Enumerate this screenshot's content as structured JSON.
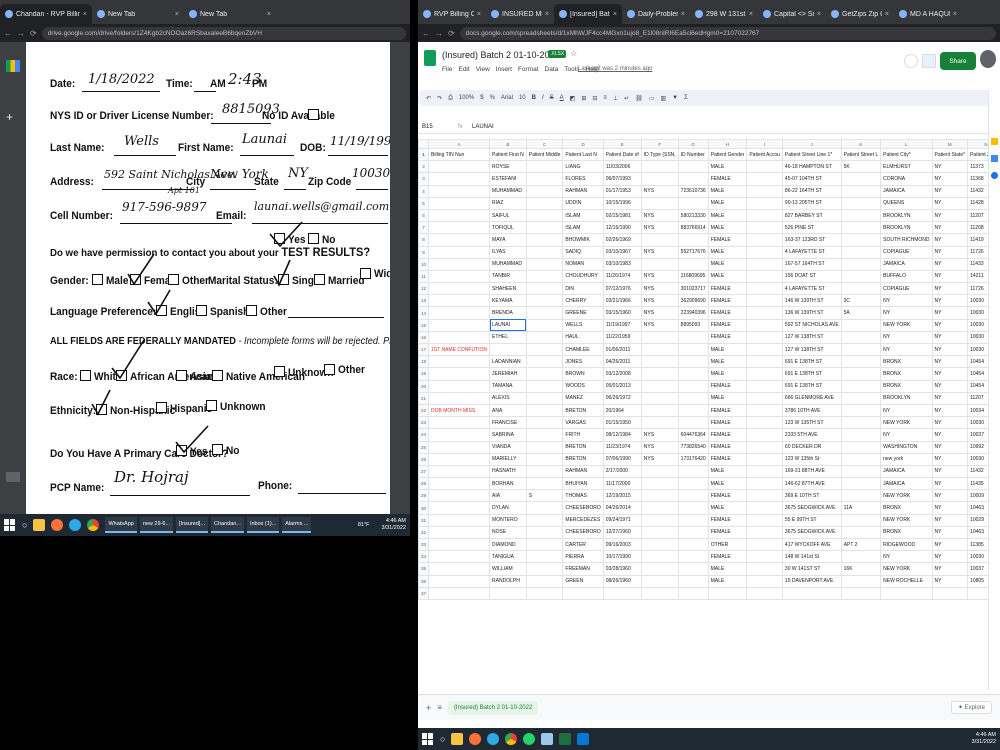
{
  "left_window": {
    "tabs": [
      {
        "label": "Chandan - RVP Billing Company"
      },
      {
        "label": "New Tab"
      },
      {
        "label": "New Tab"
      }
    ],
    "url": "drive.google.com/drive/folders/1Z4Kgb2cNOOaz6RSbaxaleeB6bqenZbVH",
    "form": {
      "date_label": "Date:",
      "date_val": "1/18/2022",
      "time_label": "Time:",
      "time_am": "AM",
      "time_val": "2:43",
      "time_pm": "PM",
      "id_label": "NYS ID or Driver License Number:",
      "id_val": "8815093",
      "noid_label": "No ID Available",
      "last_label": "Last Name:",
      "last_val": "Wells",
      "first_label": "First Name:",
      "first_val": "Launai",
      "dob_label": "DOB:",
      "dob_val": "11/19/1997",
      "addr_label": "Address:",
      "addr_val": "592 Saint Nicholas Ave.",
      "city_label": "City",
      "city_val": "New York",
      "state_label": "State",
      "state_val": "NY",
      "zip_label": "Zip Code",
      "zip_val": "10030",
      "cell_label": "Cell Number:",
      "cell_val": "917-596-9897",
      "apt_note": "Apt 101",
      "email_label": "Email:",
      "email_val": "launai.wells@gmail.com",
      "perm_label": "Do we have permission to contact you about your",
      "perm_bold": "TEST RESULTS?",
      "yes": "Yes",
      "no": "No",
      "gender_label": "Gender:",
      "male": "Male",
      "female": "Female",
      "other": "Other",
      "marital_label": "Marital Status:",
      "single": "Single",
      "married": "Married",
      "widowed": "Widowed",
      "partnered": "Partnered",
      "lang_label": "Language Preference:",
      "english": "English",
      "spanish": "Spanish",
      "lang_other": "Other",
      "mandate_bold": "ALL FIELDS ARE FEDERALLY MANDATED",
      "mandate_rest": "- Incomplete forms will be rejected. Please print legibly.",
      "race_label": "Race:",
      "white": "White",
      "african": "African American",
      "asian": "Asian",
      "native": "Native American",
      "unknown": "Unknown",
      "race_other": "Other",
      "eth_label": "Ethnicity:",
      "nonhisp": "Non-Hispanic",
      "hisp": "Hispanic",
      "eth_unknown": "Unknown",
      "pcd_label": "Do You Have A Primary Care Doctor?",
      "pcd_yes": "Yes",
      "pcd_no": "No",
      "pcp_label": "PCP Name:",
      "pcp_val": "Dr. Hojraj",
      "phone_label": "Phone:"
    },
    "taskbar": {
      "items": [
        "WhatsApp",
        "new 29-6...",
        "[Insured]...",
        "Chandan...",
        "Inbox (1)...",
        "Alarms ..."
      ],
      "temp": "81°F",
      "time": "4:46 AM",
      "date": "3/31/2022"
    }
  },
  "right_window": {
    "tabs": [
      {
        "label": "RVP Billing Company - G"
      },
      {
        "label": "INSURED MEDICAID_MEI"
      },
      {
        "label": "[Insured] Batch 2 01-10-2"
      },
      {
        "label": "Daily-Problem Data_Insu"
      },
      {
        "label": "298 W 131st St - Google I"
      },
      {
        "label": "Capital <> Small Letters C"
      },
      {
        "label": "GetZips Zip Code Lookup"
      },
      {
        "label": "MD A HAQUE - Google S"
      }
    ],
    "url": "docs.google.com/spreadsheets/d/1xMhWJF4cc4MGxn1ujo8_E1l08nIRI6Ea5ci6edHgm0=2107022767",
    "title": "(Insured) Batch 2 01-10-2022",
    "badge": ".XLSX",
    "menu": [
      "File",
      "Edit",
      "View",
      "Insert",
      "Format",
      "Data",
      "Tools",
      "Help"
    ],
    "last_edit": "Last edit was 2 minutes ago",
    "share": "Share",
    "toolbar": {
      "zoom": "100%",
      "font": "Arial",
      "size": "10"
    },
    "cell_ref": "B15",
    "formula": "LAUNAI",
    "col_letters": [
      "A",
      "B",
      "C",
      "D",
      "E",
      "F",
      "G",
      "H",
      "I",
      "J",
      "K",
      "L",
      "M",
      "N",
      "O",
      "P",
      "Q",
      "R"
    ],
    "headers": [
      "Billing TIN Nun",
      "Patient First N",
      "Patient Middle",
      "Patient Last N",
      "Patient Date of",
      "ID Type (SSN,",
      "ID Number",
      "Patient Gender",
      "Patient Accou",
      "Patient Street Line 1*",
      "Patient Street L",
      "Patient City*",
      "Patient State*",
      "Patient Zip Co",
      "Service Type (I",
      "Date of Service",
      "Date of Admis",
      "Date of Discha"
    ],
    "rows": [
      {
        "n": "2",
        "c": [
          "",
          "ROYSE",
          "",
          "LIANG",
          "11/03/2006",
          "",
          "",
          "MALE",
          "",
          "46-18 HAMPTON ST",
          "5K",
          "ELMHURST",
          "NY",
          "11373",
          "",
          "01/08/2022",
          "",
          ""
        ]
      },
      {
        "n": "3",
        "c": [
          "",
          "ESTEFANI",
          "",
          "FLORES",
          "06/07/1993",
          "",
          "",
          "FEMALE",
          "",
          "45-07 104TH ST",
          "",
          "CORONA",
          "NY",
          "11368",
          "",
          "01/05/2021",
          "",
          ""
        ]
      },
      {
        "n": "4",
        "c": [
          "",
          "MUHAMMAD",
          "",
          "RAHMAN",
          "01/17/1953",
          "NYS",
          "723610736",
          "MALE",
          "",
          "86-22 164TH ST",
          "",
          "JAMAICA",
          "NY",
          "11432",
          "",
          "01/08/2022",
          "",
          ""
        ]
      },
      {
        "n": "5",
        "c": [
          "",
          "RIAZ",
          "",
          "UDDIN",
          "10/15/1996",
          "",
          "",
          "MALE",
          "",
          "90-13 205TH ST",
          "",
          "QUEENS",
          "NY",
          "11428",
          "",
          "01/08/2022",
          "",
          ""
        ]
      },
      {
        "n": "6",
        "c": [
          "",
          "SAIFUL",
          "",
          "ISLAM",
          "02/15/1981",
          "NYS",
          "580213330",
          "MALE",
          "",
          "827 BARBEY ST",
          "",
          "BROOKLYN",
          "NY",
          "11207",
          "",
          "01/08/2022",
          "",
          ""
        ]
      },
      {
        "n": "7",
        "c": [
          "",
          "TOFIQUL",
          "",
          "ISLAM",
          "12/16/1990",
          "NYS",
          "883766914",
          "MALE",
          "",
          "526 PINE ST",
          "",
          "BROOKLYN",
          "NY",
          "11208",
          "",
          "01/08/2022",
          "",
          ""
        ]
      },
      {
        "n": "8",
        "c": [
          "",
          "MAYA",
          "",
          "BHOWMIK",
          "02/26/1969",
          "",
          "",
          "FEMALE",
          "",
          "163-37 123RD ST",
          "",
          "SOUTH RICHMOND",
          "NY",
          "11419",
          "",
          "01/08/2022",
          "",
          ""
        ]
      },
      {
        "n": "9",
        "c": [
          "",
          "ILYAS",
          "",
          "SADIQ",
          "03/10/1967",
          "NYS",
          "552717676",
          "MALE",
          "",
          "4 LAFAYETTE ST",
          "",
          "COPIAGUE",
          "NY",
          "11726",
          "",
          "01/08/2022",
          "",
          ""
        ]
      },
      {
        "n": "10",
        "c": [
          "",
          "MUHAMMAD",
          "",
          "NOMAN",
          "03/10/1983",
          "",
          "",
          "MALE",
          "",
          "167-57 164TH ST",
          "",
          "JAMAICA",
          "NY",
          "11433",
          "",
          "01/08/2022",
          "",
          ""
        ]
      },
      {
        "n": "11",
        "c": [
          "",
          "TANBIR",
          "",
          "CHOUDHURY",
          "11/26/1974",
          "NYS",
          "116809695",
          "MALE",
          "",
          "156 DOAT ST",
          "",
          "BUFFALO",
          "NY",
          "14211",
          "",
          "01/08/2022",
          "",
          ""
        ]
      },
      {
        "n": "12",
        "c": [
          "",
          "SHAHEEN",
          "",
          "DIN",
          "07/12/1976",
          "NYS",
          "301023717",
          "FEMALE",
          "",
          "4 LAFAYETTE ST",
          "",
          "COPIAGUE",
          "NY",
          "11726",
          "",
          "01/08/2022",
          "",
          ""
        ]
      },
      {
        "n": "13",
        "c": [
          "",
          "KEYAMA",
          "",
          "CHERRY",
          "03/21/1966",
          "NYS",
          "362909690",
          "FEMALE",
          "",
          "146 W 139TH ST",
          "3C",
          "NY",
          "NY",
          "10030",
          "",
          "01/08/2022",
          "",
          ""
        ]
      },
      {
        "n": "14",
        "c": [
          "",
          "BRENDA",
          "",
          "GREENE",
          "03/15/1960",
          "NYS",
          "223940396",
          "FEMALE",
          "",
          "136 W 139TH ST",
          "5A",
          "NY",
          "NY",
          "10030",
          "",
          "01/08/2022",
          "",
          ""
        ]
      },
      {
        "n": "15",
        "c": [
          "",
          "LAUNAI",
          "",
          "WELLS",
          "11/19/1997",
          "NYS",
          "8895093",
          "FEMALE",
          "",
          "592 ST NICHOLAS AVE",
          "",
          "NEW YORK",
          "NY",
          "10030",
          "",
          "01/08/2022",
          "",
          ""
        ]
      },
      {
        "n": "16",
        "c": [
          "",
          "ETHEL",
          "",
          "HAUL",
          "11/22/1959",
          "",
          "",
          "FEMALE",
          "",
          "127 W 138TH ST",
          "",
          "NY",
          "NY",
          "10030",
          "",
          "01/08/2022",
          "",
          ""
        ]
      },
      {
        "n": "17",
        "c": [
          "1ST NAME CONFUTION",
          "",
          "",
          "CHAMLEE",
          "01/06/2011",
          "",
          "",
          "MALE",
          "",
          "127 W 138TH ST",
          "",
          "NY",
          "NY",
          "10030",
          "",
          "01/08/2022",
          "",
          ""
        ]
      },
      {
        "n": "18",
        "c": [
          "",
          "LADANNIAN",
          "",
          "JONES",
          "04/26/2011",
          "",
          "",
          "MALE",
          "",
          "691 E 138TH ST",
          "",
          "BRONX",
          "NY",
          "10454",
          "",
          "01/08/2022",
          "",
          ""
        ]
      },
      {
        "n": "19",
        "c": [
          "",
          "JEREMIAH",
          "",
          "BROWN",
          "03/12/2008",
          "",
          "",
          "MALE",
          "",
          "691 E 138TH ST",
          "",
          "BRONX",
          "NY",
          "10454",
          "",
          "01/08/2022",
          "",
          ""
        ]
      },
      {
        "n": "20",
        "c": [
          "",
          "TAMANA",
          "",
          "WOODS",
          "05/01/2013",
          "",
          "",
          "FEMALE",
          "",
          "691 E 138TH ST",
          "",
          "BRONX",
          "NY",
          "10454",
          "",
          "01/08/2022",
          "",
          ""
        ]
      },
      {
        "n": "21",
        "c": [
          "",
          "ALEXIS",
          "",
          "MANEZ",
          "06/26/1972",
          "",
          "",
          "MALE",
          "",
          "666 GLENMORE AVE",
          "",
          "BROOKLYN",
          "NY",
          "11207",
          "",
          "01/08/2022",
          "",
          ""
        ]
      },
      {
        "n": "22",
        "c": [
          "DOB MONTH MISS",
          "ANA",
          "",
          "BRETON",
          "20/1964",
          "",
          "",
          "FEMALE",
          "",
          "3786 10TH AVE",
          "",
          "NY",
          "NY",
          "10034",
          "",
          "01/08/2022",
          "",
          ""
        ]
      },
      {
        "n": "23",
        "c": [
          "",
          "FRANCISE",
          "",
          "VARGAS",
          "01/15/1950",
          "",
          "",
          "FEMALE",
          "",
          "123 W 135TH ST",
          "",
          "NEW YORK",
          "NY",
          "10030",
          "",
          "01/08/2022",
          "",
          ""
        ]
      },
      {
        "n": "24",
        "c": [
          "",
          "SABRINA",
          "",
          "FRITH",
          "08/12/1984",
          "NYS",
          "604476364",
          "FEMALE",
          "",
          "2333 5TH AVE",
          "",
          "NY",
          "NY",
          "10037",
          "",
          "01/08/2022",
          "",
          ""
        ]
      },
      {
        "n": "25",
        "c": [
          "",
          "VIANDA",
          "",
          "BRETON",
          "11/23/1974",
          "NYS",
          "773826540",
          "FEMALE",
          "",
          "60 DECKER DR",
          "",
          "WASHINGTON",
          "NY",
          "10992",
          "",
          "01/08/2022",
          "",
          ""
        ]
      },
      {
        "n": "26",
        "c": [
          "",
          "MARIELLY",
          "",
          "BRETON",
          "07/06/1990",
          "NYS",
          "173176420",
          "FEMALE",
          "",
          "123 W 135th St",
          "",
          "new york",
          "NY",
          "10030",
          "",
          "01/08/2022",
          "",
          ""
        ]
      },
      {
        "n": "27",
        "c": [
          "",
          "HASNATH",
          "",
          "RAHMAN",
          "2/17/2000",
          "",
          "",
          "MALE",
          "",
          "169-31 88TH AVE",
          "",
          "JAMAICA",
          "NY",
          "11432",
          "",
          "01/08/2022",
          "",
          ""
        ]
      },
      {
        "n": "28",
        "c": [
          "",
          "BORHAN",
          "",
          "BHUIYAN",
          "11/17/2000",
          "",
          "",
          "MALE",
          "",
          "146-62 87TH AVE",
          "",
          "JAMAICA",
          "NY",
          "11435",
          "",
          "01/08/2022",
          "",
          ""
        ]
      },
      {
        "n": "29",
        "c": [
          "",
          "AIA",
          "S",
          "THOMAS",
          "12/19/2015",
          "",
          "",
          "FEMALE",
          "",
          "369 E 10TH ST",
          "",
          "NEW YORK",
          "NY",
          "10009",
          "",
          "01/08/2022",
          "",
          ""
        ]
      },
      {
        "n": "30",
        "c": [
          "",
          "DYLAN",
          "",
          "CHEESEBORO",
          "04/26/2014",
          "",
          "",
          "MALE",
          "",
          "3675 SEDGWICK AVE",
          "11A",
          "BRONX",
          "NY",
          "10463",
          "",
          "01/08/2022",
          "",
          ""
        ]
      },
      {
        "n": "31",
        "c": [
          "",
          "MONTERO",
          "",
          "MERCEDEZES",
          "09/24/1971",
          "",
          "",
          "FEMALE",
          "",
          "55 E 99TH ST",
          "",
          "NEW YORK",
          "NY",
          "10029",
          "",
          "01/08/2022",
          "",
          ""
        ]
      },
      {
        "n": "32",
        "c": [
          "",
          "NOSE",
          "",
          "CHEESEBORO",
          "12/27/1960",
          "",
          "",
          "FEMALE",
          "",
          "3675 SEDGWICK AVE",
          "",
          "BRONX",
          "NY",
          "10463",
          "",
          "01/08/2022",
          "",
          ""
        ]
      },
      {
        "n": "33",
        "c": [
          "",
          "DIAMOND",
          "",
          "CARTER",
          "09/16/2003",
          "",
          "",
          "OTHER",
          "",
          "417 WYCKOFF AVE",
          "APT 2",
          "RIDGEWOOD",
          "NY",
          "11385",
          "",
          "01/08/2022",
          "",
          ""
        ]
      },
      {
        "n": "34",
        "c": [
          "",
          "TANIGUA",
          "",
          "PIERRA",
          "10/17/1990",
          "",
          "",
          "FEMALE",
          "",
          "148 W 141st St",
          "",
          "NY",
          "NY",
          "10030",
          "",
          "01/08/2022",
          "",
          ""
        ]
      },
      {
        "n": "35",
        "c": [
          "",
          "WILLIAM",
          "",
          "FREEMAN",
          "03/28/1960",
          "",
          "",
          "MALE",
          "",
          "30 W 141ST ST",
          "16K",
          "NEW YORK",
          "NY",
          "10037",
          "",
          "01/08/2022",
          "",
          ""
        ]
      },
      {
        "n": "36",
        "c": [
          "",
          "RANDOLPH",
          "",
          "GREEN",
          "08/26/1960",
          "",
          "",
          "MALE",
          "",
          "15 DAVENPORT AVE",
          "",
          "NEW ROCHELLE",
          "NY",
          "10805",
          "",
          "01/08/2022",
          "",
          ""
        ]
      },
      {
        "n": "37",
        "c": [
          "",
          "",
          "",
          "",
          "",
          "",
          "",
          "",
          "",
          "",
          "",
          "",
          "",
          "",
          "",
          "",
          "",
          ""
        ]
      }
    ],
    "sheet_tab": "(Insured) Batch 2 01-10-2022",
    "explore": "Explore",
    "taskbar": {
      "time": "4:46 AM",
      "date": "3/31/2022"
    }
  }
}
